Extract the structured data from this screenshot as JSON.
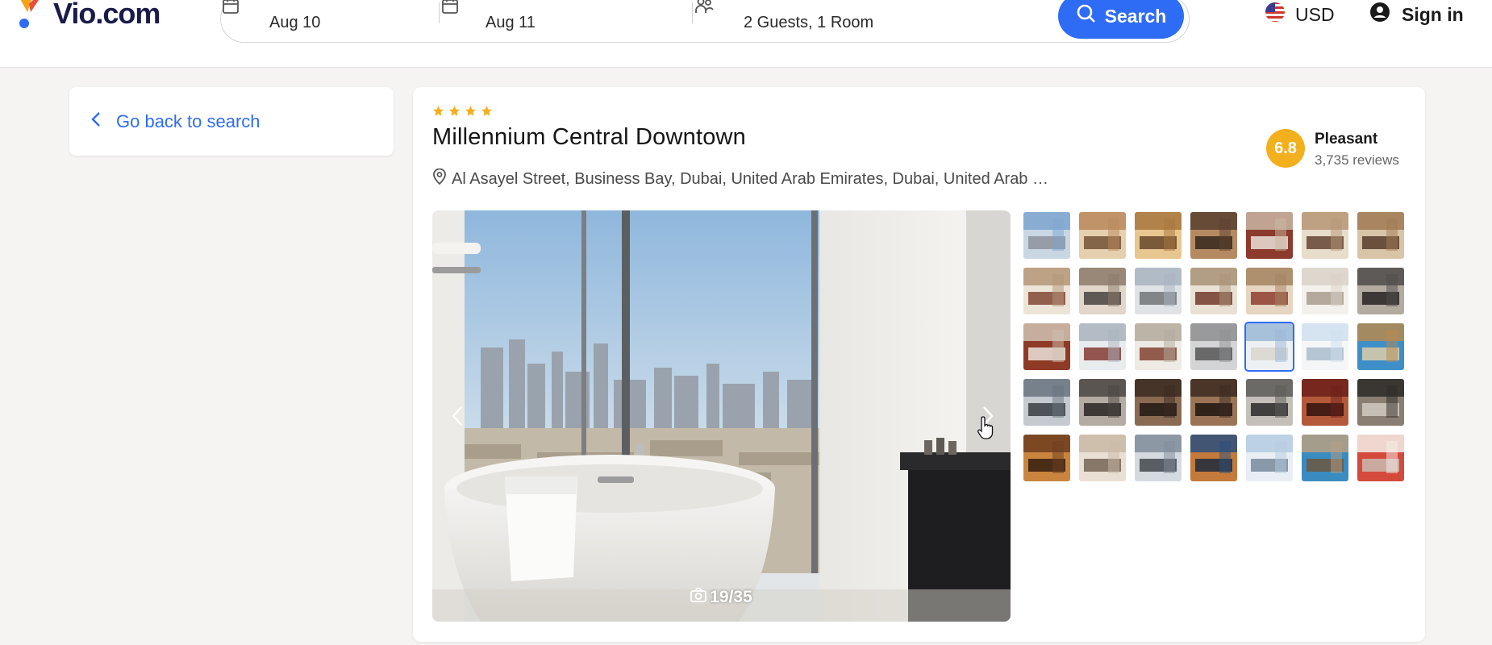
{
  "header": {
    "logo_text": "Vio.com",
    "checkin": "Aug 10",
    "checkout": "Aug 11",
    "guests": "2 Guests, 1 Room",
    "search_label": "Search",
    "currency": "USD",
    "signin_label": "Sign in"
  },
  "sidebar": {
    "back_label": "Go back to search"
  },
  "hotel": {
    "star_count": 4,
    "name": "Millennium Central Downtown",
    "address": "Al Asayel Street, Business Bay, Dubai, United Arab Emirates, Dubai, United Arab …",
    "rating_score": "6.8",
    "rating_label": "Pleasant",
    "reviews": "3,735 reviews"
  },
  "gallery": {
    "counter": "19/35",
    "active_index": 18,
    "thumbnail_count": 35
  },
  "colors": {
    "accent": "#2f6cf5",
    "star": "#f2b01e",
    "rating_badge": "#f2b01e"
  }
}
